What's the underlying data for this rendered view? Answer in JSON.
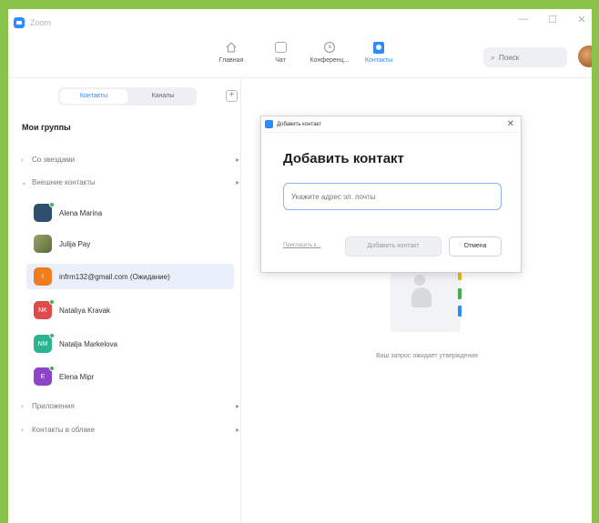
{
  "window": {
    "title": "Zoom"
  },
  "window_controls": {
    "minimize": "—",
    "maximize": "☐",
    "close": "✕"
  },
  "toolbar": {
    "tabs": [
      {
        "label": "Главная",
        "icon": "home-icon"
      },
      {
        "label": "Чат",
        "icon": "chat-icon"
      },
      {
        "label": "Конференц...",
        "icon": "clock-icon"
      },
      {
        "label": "Контакты",
        "icon": "contacts-icon",
        "active": true
      }
    ],
    "search_placeholder": "Поиск"
  },
  "left_pane": {
    "segments": [
      "Контакты",
      "Каналы"
    ],
    "active_segment": "Контакты",
    "groups_title": "Мои группы",
    "groups": [
      {
        "label": "Со звездами"
      },
      {
        "label": "Внешние контакты"
      }
    ],
    "contacts": [
      {
        "name": "Alena Marina",
        "initials": "",
        "color": "#2f4f6f",
        "online": true
      },
      {
        "name": "Julija Pay",
        "initials": "",
        "color": "#7f8f5a",
        "online": false
      },
      {
        "name": "infrm132@gmail.com (Ожидание)",
        "initials": "I",
        "color": "#f07d1f",
        "online": false,
        "selected": true
      },
      {
        "name": "Nataliya Kravak",
        "initials": "NK",
        "color": "#e04a4a",
        "online": true
      },
      {
        "name": "Natalja Markelova",
        "initials": "NM",
        "color": "#2bb58f",
        "online": true
      },
      {
        "name": "Elena Mipr",
        "initials": "E",
        "color": "#8e44c9",
        "online": true
      }
    ],
    "groups_bottom": [
      {
        "label": "Приложения"
      },
      {
        "label": "Контакты в облаке"
      }
    ]
  },
  "right_pane": {
    "empty_text": "Ваш запрос ожидает утверждения"
  },
  "dialog": {
    "window_title": "Добавить контакт",
    "heading": "Добавить контакт",
    "input_placeholder": "Укажите адрес эл. почты",
    "link": "Пригласить к...",
    "add_button": "Добавить контакт",
    "cancel_button": "Отмена"
  },
  "colors": {
    "accent": "#2d8cff",
    "frame": "#8bc34a"
  }
}
